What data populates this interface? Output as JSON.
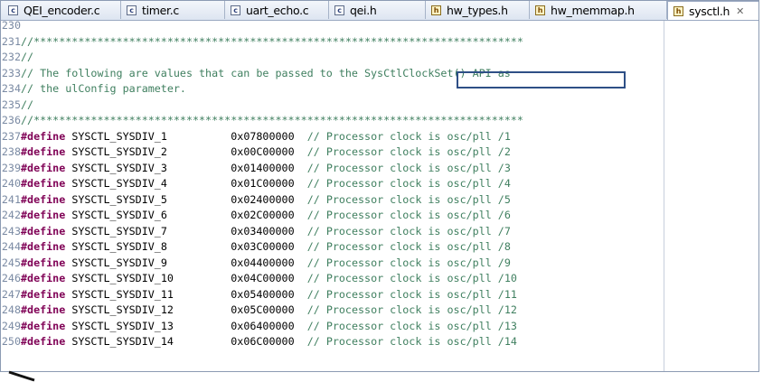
{
  "tabs": [
    {
      "label": "QEI_encoder.c",
      "kind": "c"
    },
    {
      "label": "timer.c",
      "kind": "c"
    },
    {
      "label": "uart_echo.c",
      "kind": "c"
    },
    {
      "label": "qei.h",
      "kind": "c"
    },
    {
      "label": "hw_types.h",
      "kind": "h"
    },
    {
      "label": "hw_memmap.h",
      "kind": "h"
    },
    {
      "label": "sysctl.h",
      "kind": "h",
      "active": true,
      "close": "✕"
    }
  ],
  "lines": [
    {
      "n": "230",
      "text": ""
    },
    {
      "n": "231",
      "text": "//*****************************************************************************"
    },
    {
      "n": "232",
      "text": "//"
    },
    {
      "n": "233",
      "text": "// The following are values that can be passed to the SysCtlClockSet() API as"
    },
    {
      "n": "234",
      "text": "// the ulConfig parameter."
    },
    {
      "n": "235",
      "text": "//"
    },
    {
      "n": "236",
      "text": "//*****************************************************************************"
    },
    {
      "n": "237",
      "define": "SYSCTL_SYSDIV_1",
      "value": "0x07800000",
      "comment": "// Processor clock is osc/pll /1"
    },
    {
      "n": "238",
      "define": "SYSCTL_SYSDIV_2",
      "value": "0x00C00000",
      "comment": "// Processor clock is osc/pll /2"
    },
    {
      "n": "239",
      "define": "SYSCTL_SYSDIV_3",
      "value": "0x01400000",
      "comment": "// Processor clock is osc/pll /3"
    },
    {
      "n": "240",
      "define": "SYSCTL_SYSDIV_4",
      "value": "0x01C00000",
      "comment": "// Processor clock is osc/pll /4"
    },
    {
      "n": "241",
      "define": "SYSCTL_SYSDIV_5",
      "value": "0x02400000",
      "comment": "// Processor clock is osc/pll /5"
    },
    {
      "n": "242",
      "define": "SYSCTL_SYSDIV_6",
      "value": "0x02C00000",
      "comment": "// Processor clock is osc/pll /6"
    },
    {
      "n": "243",
      "define": "SYSCTL_SYSDIV_7",
      "value": "0x03400000",
      "comment": "// Processor clock is osc/pll /7"
    },
    {
      "n": "244",
      "define": "SYSCTL_SYSDIV_8",
      "value": "0x03C00000",
      "comment": "// Processor clock is osc/pll /8"
    },
    {
      "n": "245",
      "define": "SYSCTL_SYSDIV_9",
      "value": "0x04400000",
      "comment": "// Processor clock is osc/pll /9"
    },
    {
      "n": "246",
      "define": "SYSCTL_SYSDIV_10",
      "value": "0x04C00000",
      "comment": "// Processor clock is osc/pll /10"
    },
    {
      "n": "247",
      "define": "SYSCTL_SYSDIV_11",
      "value": "0x05400000",
      "comment": "// Processor clock is osc/pll /11"
    },
    {
      "n": "248",
      "define": "SYSCTL_SYSDIV_12",
      "value": "0x05C00000",
      "comment": "// Processor clock is osc/pll /12"
    },
    {
      "n": "249",
      "define": "SYSCTL_SYSDIV_13",
      "value": "0x06400000",
      "comment": "// Processor clock is osc/pll /13"
    },
    {
      "n": "250",
      "define": "SYSCTL_SYSDIV_14",
      "value": "0x06C00000",
      "comment": "// Processor clock is osc/pll /14"
    }
  ],
  "keyword": "#define",
  "highlight_text": "SysCtlClockSet() API",
  "colors": {
    "comment": "#3f7f5f",
    "keyword": "#7f0055",
    "line_number": "#7a8aa3",
    "highlight_box": "#2e4f86",
    "tab_bar": "#dde5f1"
  }
}
